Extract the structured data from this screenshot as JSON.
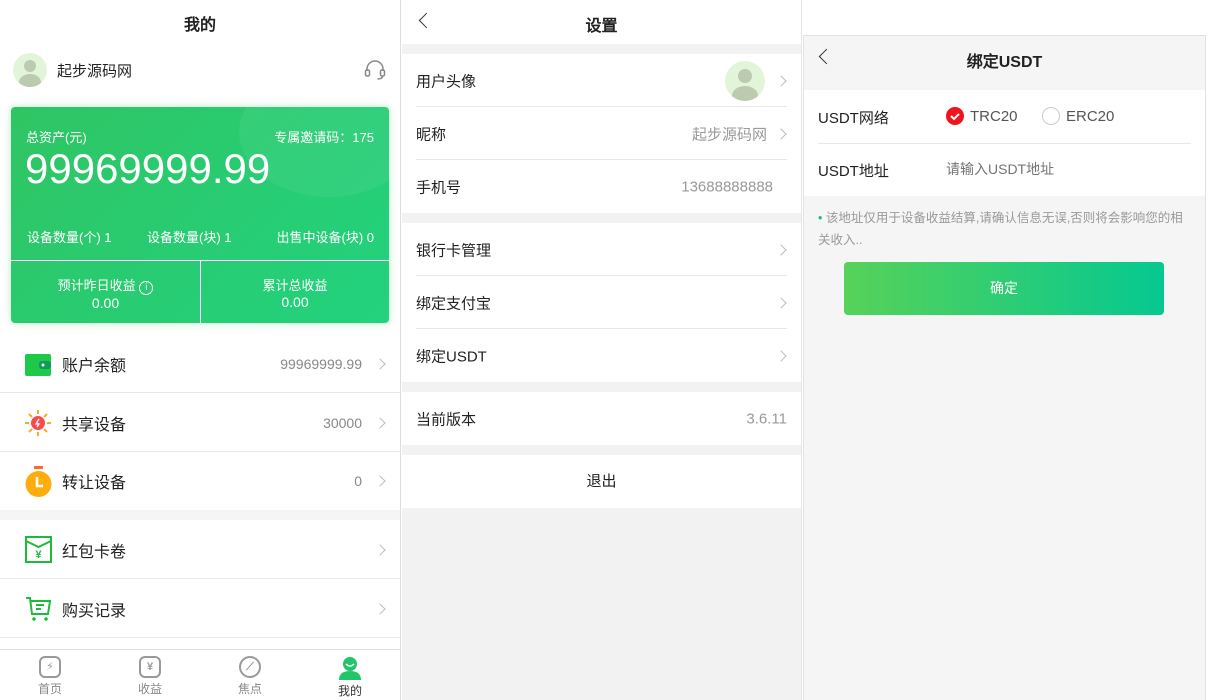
{
  "mine": {
    "title": "我的",
    "username": "起步源码网",
    "card": {
      "assets_label": "总资产(元)",
      "invite_label": "专属邀请码：175",
      "assets": "99969999.99",
      "stats": [
        "设备数量(个) 1",
        "设备数量(块) 1",
        "出售中设备(块) 0"
      ],
      "yesterday_label": "预计昨日收益",
      "yesterday": "0.00",
      "total_label": "累计总收益",
      "total": "0.00"
    },
    "menu": [
      {
        "label": "账户余额",
        "value": "99969999.99"
      },
      {
        "label": "共享设备",
        "value": "30000"
      },
      {
        "label": "转让设备",
        "value": "0"
      },
      {
        "label": "红包卡卷",
        "value": ""
      },
      {
        "label": "购买记录",
        "value": ""
      }
    ],
    "nav": [
      {
        "label": "首页"
      },
      {
        "label": "收益"
      },
      {
        "label": "焦点"
      },
      {
        "label": "我的"
      }
    ]
  },
  "settings": {
    "title": "设置",
    "rows": [
      {
        "label": "用户头像"
      },
      {
        "label": "昵称",
        "value": "起步源码网"
      },
      {
        "label": "手机号",
        "value": "13688888888"
      },
      {
        "label": "银行卡管理"
      },
      {
        "label": "绑定支付宝"
      },
      {
        "label": "绑定USDT"
      },
      {
        "label": "当前版本",
        "value": "3.6.11"
      }
    ],
    "logout": "退出"
  },
  "usdt": {
    "title": "绑定USDT",
    "network_label": "USDT网络",
    "options": [
      "TRC20",
      "ERC20"
    ],
    "selected": "TRC20",
    "address_label": "USDT地址",
    "address_placeholder": "请输入USDT地址",
    "note": "该地址仅用于设备收益结算,请确认信息无误,否则将会影响您的相关收入..",
    "confirm": "确定",
    "accent": "#f0141e"
  }
}
